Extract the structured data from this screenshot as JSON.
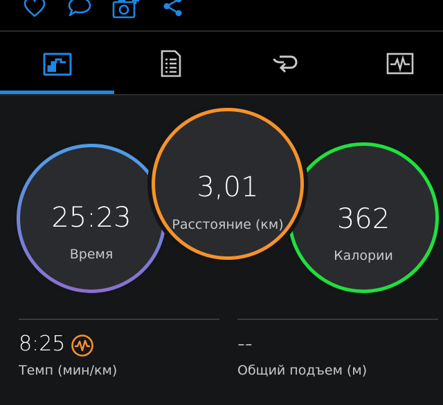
{
  "colors": {
    "accent": "#1e88e5",
    "time_ring_top": "#4c9ee8",
    "time_ring_bottom": "#8d6fd0",
    "distance_ring": "#f5932a",
    "calories_ring": "#1fe03c",
    "pace_icon": "#f5932a"
  },
  "toolbar": {
    "actions": [
      {
        "icon": "heart-icon"
      },
      {
        "icon": "comment-icon"
      },
      {
        "icon": "add-photo-icon"
      },
      {
        "icon": "share-icon"
      }
    ]
  },
  "tabs": [
    {
      "icon": "summary-chart-icon",
      "selected": true
    },
    {
      "icon": "details-list-icon",
      "selected": false
    },
    {
      "icon": "laps-icon",
      "selected": false
    },
    {
      "icon": "charts-pulse-icon",
      "selected": false
    }
  ],
  "gauges": {
    "time": {
      "value": "25:23",
      "label": "Время"
    },
    "distance": {
      "value": "3,01",
      "label": "Расстояние (км)"
    },
    "calories": {
      "value": "362",
      "label": "Калории"
    }
  },
  "stats": {
    "pace": {
      "value": "8:25",
      "label": "Темп (мин/км)",
      "icon": "pace-pulse-icon"
    },
    "ascent": {
      "value": "--",
      "label": "Общий подъем (м)"
    }
  }
}
